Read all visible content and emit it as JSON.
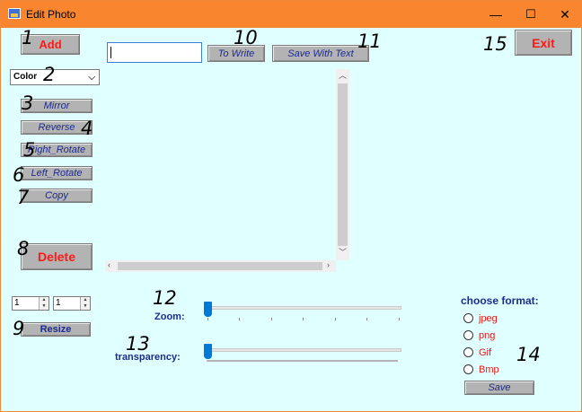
{
  "window": {
    "title": "Edit Photo",
    "minimize": "—",
    "maximize": "☐",
    "close": "✕"
  },
  "buttons": {
    "add": "Add",
    "mirror": "Mirror",
    "reverse": "Reverse",
    "right_rotate": "Right_Rotate",
    "left_rotate": "Left_Rotate",
    "copy": "Copy",
    "delete": "Delete",
    "resize": "Resize",
    "to_write": "To Write",
    "save_with_text": "Save With Text",
    "exit": "Exit",
    "save": "Save"
  },
  "text_input": {
    "value": ""
  },
  "color_select": {
    "value": "Color",
    "arrow": "⌵"
  },
  "resize_spinners": [
    {
      "value": "1"
    },
    {
      "value": "1"
    }
  ],
  "zoom": {
    "label": "Zoom:",
    "value": 0
  },
  "transparency": {
    "label": "transparency:",
    "value": 0
  },
  "format": {
    "title": "choose format:",
    "options": [
      "jpeg",
      "png",
      "Gif",
      "Bmp"
    ]
  },
  "annotations": [
    "1",
    "2",
    "3",
    "4",
    "5",
    "6",
    "7",
    "8",
    "9",
    "10",
    "11",
    "12",
    "13",
    "14",
    "15"
  ]
}
